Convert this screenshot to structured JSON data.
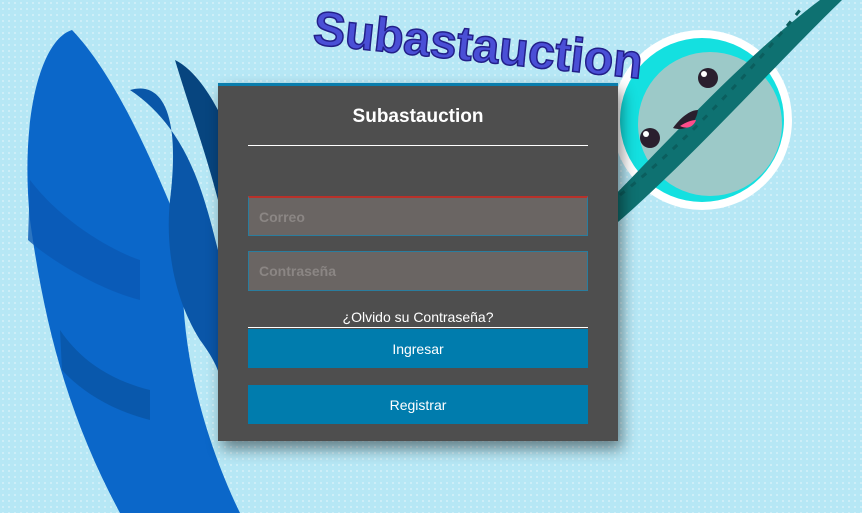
{
  "background": {
    "logo_text": "Subastauction",
    "colors": {
      "sky": "#b6e7f5",
      "blue_mark": "#0b67c9",
      "planet": "#9cc9c8",
      "ring": "#0e7171",
      "planet_glow": "#14e0e0",
      "logo_text": "#4a4fd6"
    }
  },
  "card": {
    "title": "Subastauction",
    "accent": "#0a7dac",
    "background": "#4e4e4e"
  },
  "form": {
    "email_placeholder": "Correo",
    "password_placeholder": "Contraseña",
    "forgot_label": "¿Olvido su Contraseña?",
    "login_label": "Ingresar",
    "register_label": "Registrar",
    "button_color": "#007cad"
  }
}
